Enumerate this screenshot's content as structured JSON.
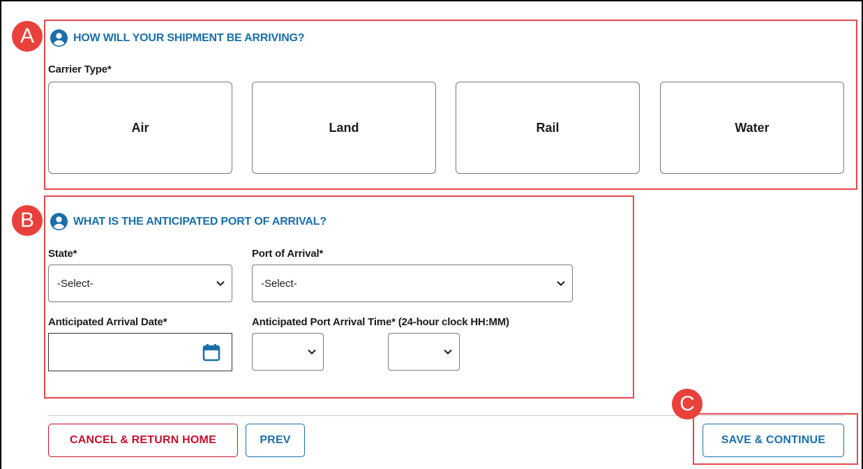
{
  "annotations": {
    "marker_a": "A",
    "marker_b": "B",
    "marker_c": "C",
    "highlight_color": "#e5484d"
  },
  "section_shipment": {
    "title": "HOW WILL YOUR SHIPMENT BE ARRIVING?",
    "icon": "user-circle-icon",
    "carrier_type_label": "Carrier Type*",
    "carrier_options": [
      "Air",
      "Land",
      "Rail",
      "Water"
    ]
  },
  "section_port": {
    "title": "WHAT IS THE ANTICIPATED PORT OF ARRIVAL?",
    "icon": "user-circle-icon",
    "state_label": "State*",
    "state_value": "-Select-",
    "port_label": "Port of Arrival*",
    "port_value": "-Select-",
    "date_label": "Anticipated Arrival Date*",
    "date_value": "",
    "date_icon": "calendar-icon",
    "time_label": "Anticipated Port Arrival Time* (24-hour clock HH:MM)",
    "hour_value": "",
    "minute_value": ""
  },
  "footer": {
    "cancel_label": "CANCEL & RETURN HOME",
    "prev_label": "PREV",
    "save_label": "SAVE & CONTINUE"
  },
  "colors": {
    "accent": "#1a6fa8",
    "danger": "#c8102e",
    "marker": "#e8413c"
  }
}
